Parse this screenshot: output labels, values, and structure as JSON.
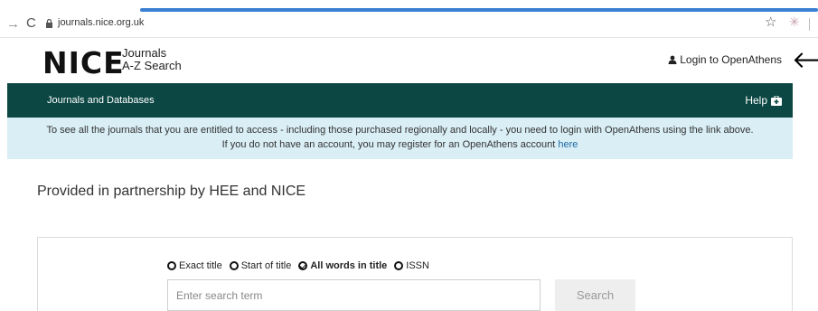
{
  "browser": {
    "url": "journals.nice.org.uk",
    "back_icon": "arrow-right-icon",
    "reload_icon": "reload-icon",
    "bookmark_icon": "star-icon"
  },
  "header": {
    "logo_text": "NICE",
    "logo_line1": "Journals",
    "logo_line2": "A-Z Search",
    "login_label": "Login to OpenAthens"
  },
  "navbar": {
    "title": "Journals and Databases",
    "help_label": "Help",
    "color": "#0c4743"
  },
  "banner": {
    "line1": "To see all the journals that you are entitled to access - including those purchased regionally and locally - you need to login with OpenAthens using the link above.",
    "line2_prefix": "If you do not have an account, you may register for an OpenAthens account",
    "line2_link": "here",
    "color": "#d9eef5"
  },
  "partner_text": "Provided in partnership by HEE and NICE",
  "search": {
    "options": [
      {
        "label": "Exact title",
        "selected": false
      },
      {
        "label": "Start of title",
        "selected": false
      },
      {
        "label": "All words in title",
        "selected": true
      },
      {
        "label": "ISSN",
        "selected": false
      }
    ],
    "placeholder": "Enter search term",
    "button_label": "Search"
  }
}
